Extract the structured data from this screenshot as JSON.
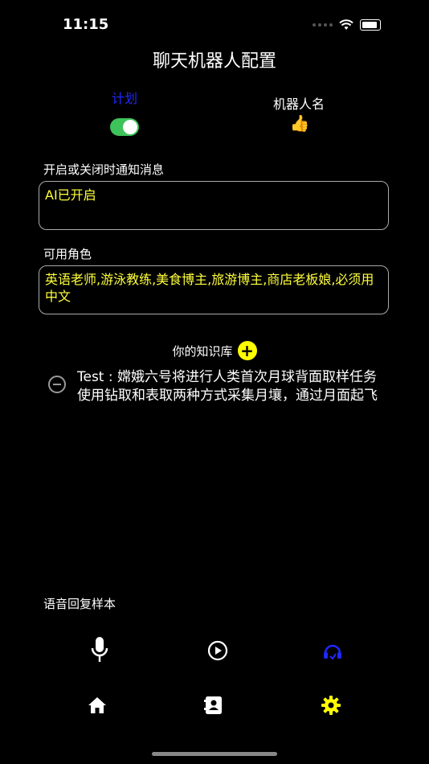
{
  "status_bar": {
    "time": "11:15",
    "wifi_icon": "wifi-icon",
    "battery_icon": "battery-icon"
  },
  "header": {
    "title": "聊天机器人配置"
  },
  "plan": {
    "label": "计划",
    "enabled": true,
    "label_color": "#1f28ff",
    "toggle_color": "#3ec25a"
  },
  "bot_name": {
    "label": "机器人名",
    "emoji": "👍"
  },
  "notify": {
    "label": "开启或关闭时通知消息",
    "value": "AI已开启"
  },
  "roles": {
    "label": "可用角色",
    "value": "英语老师,游泳教练,美食博主,旅游博主,商店老板娘,必须用中文"
  },
  "knowledge": {
    "label": "你的知识库",
    "items": [
      {
        "text": "Test : 嫦娥六号将进行人类首次月球背面取样任务使用钻取和表取两种方式采集月壤，通过月面起飞"
      }
    ]
  },
  "voice": {
    "label": "语音回复样本"
  },
  "controls": {
    "mic_icon": "microphone-icon",
    "play_icon": "play-icon",
    "support_icon": "headset-icon"
  },
  "tabbar": {
    "home_icon": "home-icon",
    "contacts_icon": "contacts-icon",
    "settings_icon": "settings-gear-icon",
    "active_color": "#ffff00"
  },
  "colors": {
    "background": "#000000",
    "accent_yellow": "#ffff3a",
    "accent_blue": "#1f28ff"
  }
}
